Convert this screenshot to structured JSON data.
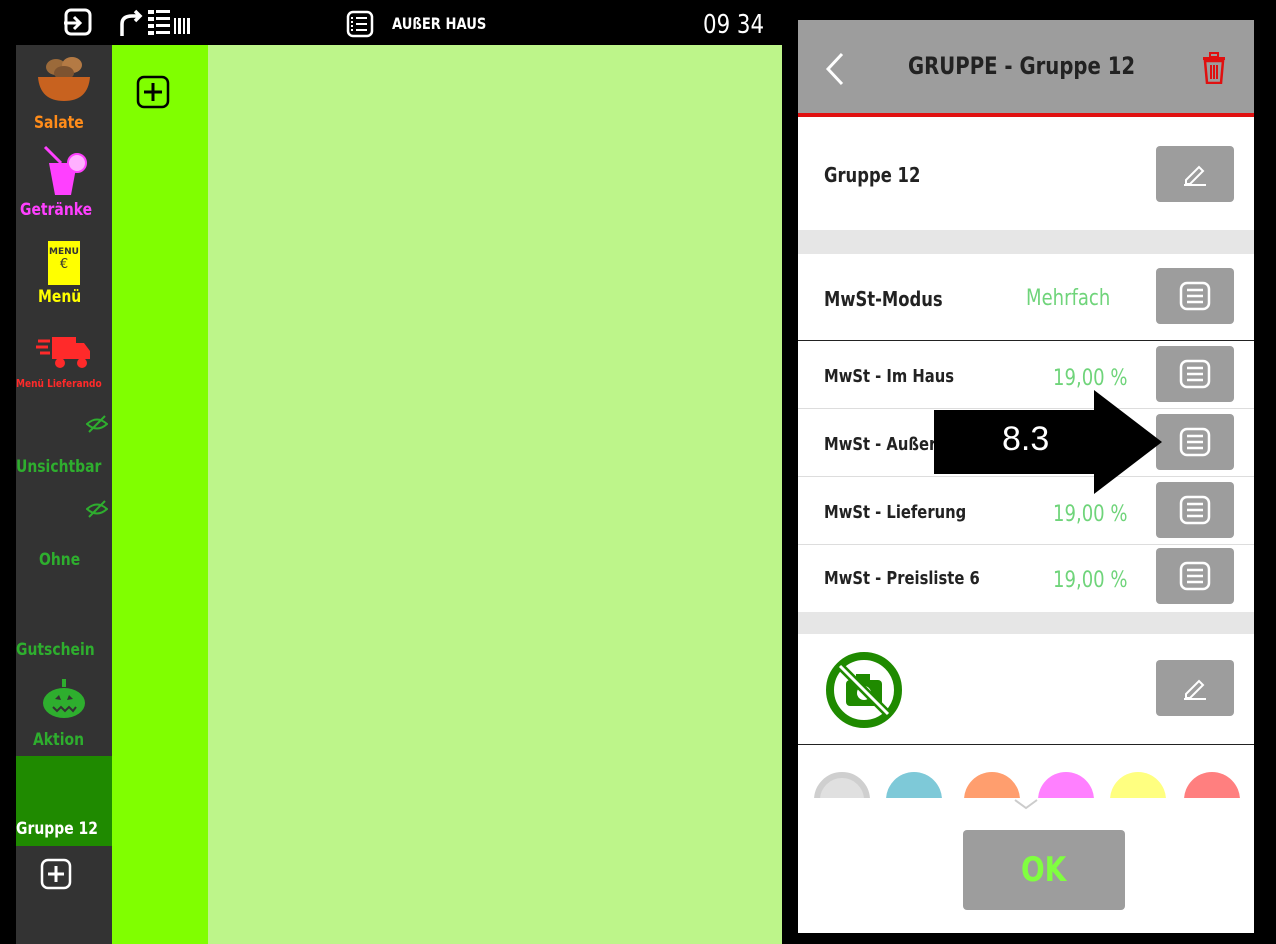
{
  "topbar": {
    "order_mode": "AUßER HAUS",
    "clock": "09 34"
  },
  "sidebar": {
    "items": [
      {
        "label": "Salate",
        "color": "#ff8c1a"
      },
      {
        "label": "Getränke",
        "color": "#ff40ff"
      },
      {
        "label": "Menü",
        "color": "#ffff00"
      },
      {
        "label": "Menü Lieferando",
        "color": "#ff2a2a"
      },
      {
        "label": "Unsichtbar",
        "color": "#2eae2e"
      },
      {
        "label": "Ohne",
        "color": "#2eae2e"
      },
      {
        "label": "Gutschein",
        "color": "#2eae2e"
      },
      {
        "label": "Aktion",
        "color": "#2eae2e"
      },
      {
        "label": "Gruppe 12",
        "color": "#ffffff"
      }
    ],
    "menu_icon_text": "MENU",
    "menu_icon_symbol": "€"
  },
  "dialog": {
    "title": "GRUPPE - Gruppe 12",
    "group_name": "Gruppe 12",
    "mwst_mode_label": "MwSt-Modus",
    "mwst_mode_value": "Mehrfach",
    "tax_rows": [
      {
        "label": "MwSt - Im Haus",
        "value": "19,00 %"
      },
      {
        "label": "MwSt - Außer",
        "value": ""
      },
      {
        "label": "MwSt - Lieferung",
        "value": "19,00 %"
      },
      {
        "label": "MwSt - Preisliste 6",
        "value": "19,00 %"
      }
    ],
    "ok_label": "OK",
    "swatch_colors": [
      "#d8d8d8",
      "#7ec9d8",
      "#ff9e6e",
      "#ff80ff",
      "#ffff80",
      "#ff7f7f"
    ]
  },
  "annotation": {
    "label": "8.3"
  }
}
